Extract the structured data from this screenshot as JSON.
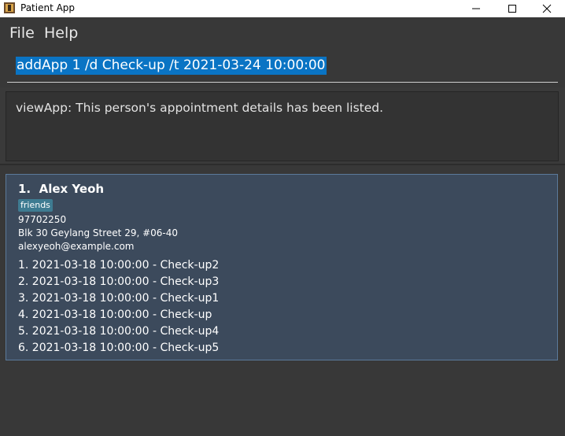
{
  "window": {
    "title": "Patient App"
  },
  "menu": {
    "file": "File",
    "help": "Help"
  },
  "command": {
    "value": "addApp 1 /d Check-up /t 2021-03-24 10:00:00"
  },
  "result": {
    "text": "viewApp: This person's appointment details has been listed."
  },
  "person": {
    "index": "1.",
    "name": "Alex Yeoh",
    "tag": "friends",
    "phone": "97702250",
    "address": "Blk 30 Geylang Street 29, #06-40",
    "email": "alexyeoh@example.com",
    "appointments": [
      "1. 2021-03-18 10:00:00 - Check-up2",
      "2. 2021-03-18 10:00:00 - Check-up3",
      "3. 2021-03-18 10:00:00 - Check-up1",
      "4. 2021-03-18 10:00:00 - Check-up",
      "5. 2021-03-18 10:00:00 - Check-up4",
      "6. 2021-03-18 10:00:00 - Check-up5"
    ]
  },
  "colors": {
    "background": "#383838",
    "card": "#3c4a5c",
    "card_border": "#5b7a9a",
    "selection": "#0a74c4",
    "tag": "#3e7b91"
  },
  "icons": {
    "app": "app-icon",
    "minimize": "minimize-icon",
    "maximize": "maximize-icon",
    "close": "close-icon"
  }
}
